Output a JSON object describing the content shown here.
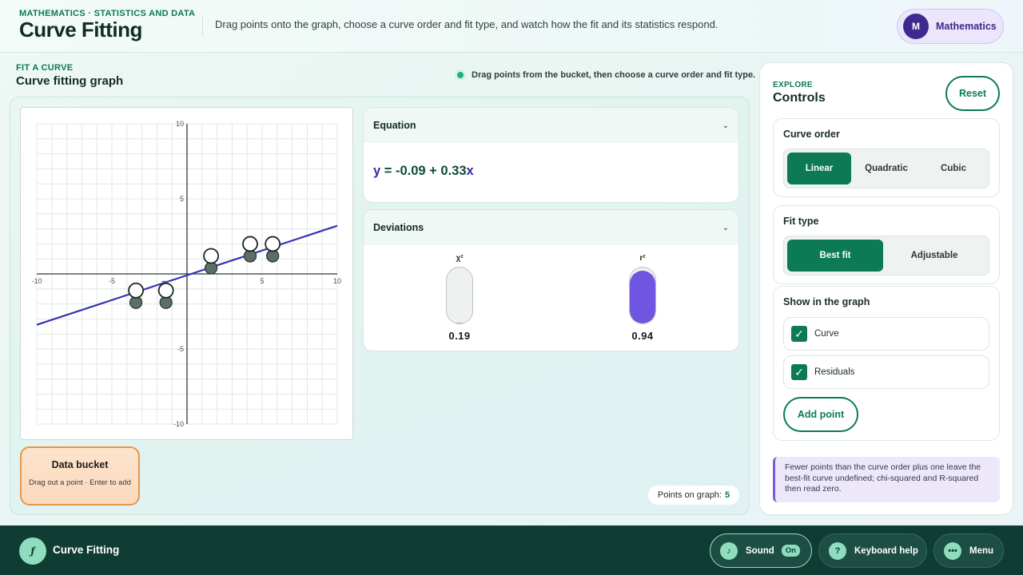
{
  "header": {
    "eyebrow": "MATHEMATICS · STATISTICS AND DATA",
    "title": "Curve Fitting",
    "description": "Drag points onto the graph, choose a curve order and fit type, and watch how the fit and its statistics respond.",
    "subject": {
      "initial": "M",
      "label": "Mathematics"
    }
  },
  "section": {
    "eyebrow": "FIT A CURVE",
    "title": "Curve fitting graph",
    "hint": "Drag points from the bucket, then choose a curve order and fit type."
  },
  "graph": {
    "xlim": [
      -10,
      10
    ],
    "ylim": [
      -10,
      10
    ],
    "tick_labels": {
      "x": [
        "-10",
        "-5",
        "5",
        "10"
      ],
      "y": [
        "10",
        "5",
        "-5",
        "-10"
      ]
    },
    "points": [
      {
        "x": -3.4,
        "y": -1.9
      },
      {
        "x": -1.4,
        "y": -1.9
      },
      {
        "x": 1.6,
        "y": 0.4
      },
      {
        "x": 4.2,
        "y": 1.2
      },
      {
        "x": 5.7,
        "y": 1.2
      }
    ],
    "fit_line": {
      "intercept": -0.09,
      "slope": 0.33
    },
    "colors": {
      "line": "#3434b3",
      "point": "#5b6e68",
      "handle": "#ffffff"
    }
  },
  "bucket": {
    "title": "Data bucket",
    "subtitle": "Drag out a point · Enter to add"
  },
  "equation": {
    "title": "Equation",
    "y": "y",
    "rhs": " = -0.09 + 0.33",
    "x": "x"
  },
  "deviations": {
    "title": "Deviations",
    "chi_label": "χ²",
    "chi_value": "0.19",
    "chi_fraction": 0.02,
    "r_label": "r²",
    "r_value": "0.94",
    "r_fraction": 0.94,
    "r_color": "#6f55e0"
  },
  "points_on_graph": {
    "label": "Points on graph:",
    "count": "5"
  },
  "controls": {
    "eyebrow": "EXPLORE",
    "title": "Controls",
    "reset": "Reset",
    "curve_order": {
      "title": "Curve order",
      "options": [
        "Linear",
        "Quadratic",
        "Cubic"
      ],
      "selected": "Linear"
    },
    "fit_type": {
      "title": "Fit type",
      "options": [
        "Best fit",
        "Adjustable"
      ],
      "selected": "Best fit"
    },
    "show": {
      "title": "Show in the graph",
      "curve": "Curve",
      "residuals": "Residuals",
      "curve_checked": true,
      "residuals_checked": true
    },
    "add_point": "Add point",
    "note": "Fewer points than the curve order plus one leave the best-fit curve undefined; chi-squared and R-squared then read zero."
  },
  "footer": {
    "logo": "ƒ",
    "title": "Curve Fitting",
    "sound": {
      "label": "Sound",
      "icon": "music-note-icon",
      "state": "On"
    },
    "keyboard": {
      "label": "Keyboard help",
      "icon": "question-icon"
    },
    "menu": {
      "label": "Menu",
      "icon": "dots-icon"
    }
  },
  "theme": {
    "accent": "#0b7a55",
    "footer_bg": "#0f3c33",
    "purple": "#3b2a86"
  }
}
